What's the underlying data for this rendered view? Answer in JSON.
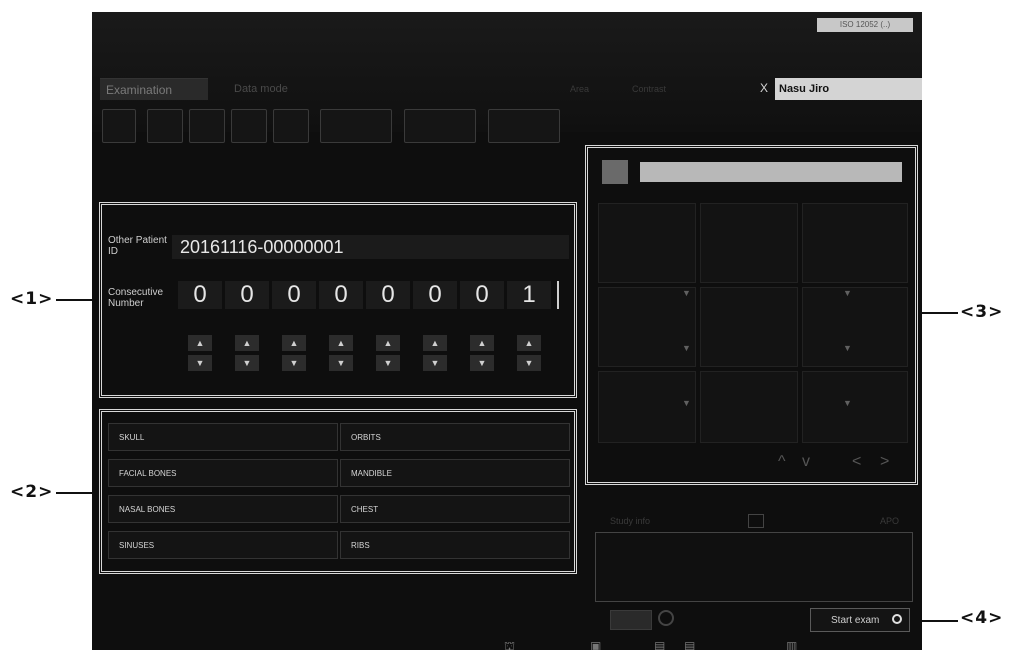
{
  "header": {
    "iso_label": "ISO 12052 (..)",
    "tabs": [
      {
        "label": "Examination"
      },
      {
        "label": "Data mode"
      }
    ],
    "dim_labels": [
      "Area",
      "Contrast"
    ],
    "x_mark": "X",
    "operator_name": "Nasu Jiro"
  },
  "patient": {
    "other_id_label": "Other Patient ID",
    "other_id_value": "20161116-00000001",
    "consecutive_label": "Consecutive Number",
    "digits": [
      "0",
      "0",
      "0",
      "0",
      "0",
      "0",
      "0",
      "1"
    ],
    "up_arrow": "▲",
    "down_arrow": "▼"
  },
  "body_parts": [
    "SKULL",
    "ORBITS",
    "FACIAL BONES",
    "MANDIBLE",
    "NASAL BONES",
    "CHEST",
    "SINUSES",
    "RIBS"
  ],
  "right_panel": {
    "nav": [
      "^",
      "v",
      "<",
      ">"
    ],
    "dropdown_glyph": "▼",
    "study_label": "Study info",
    "apo_label": "APO"
  },
  "footer": {
    "start_label": "Start exam"
  },
  "callouts": [
    "<1>",
    "<2>",
    "<3>",
    "<4>"
  ],
  "colors": {
    "background": "#0e0e0e",
    "frame": "#d8d8d8",
    "operator_bar": "#d4d4d4"
  }
}
